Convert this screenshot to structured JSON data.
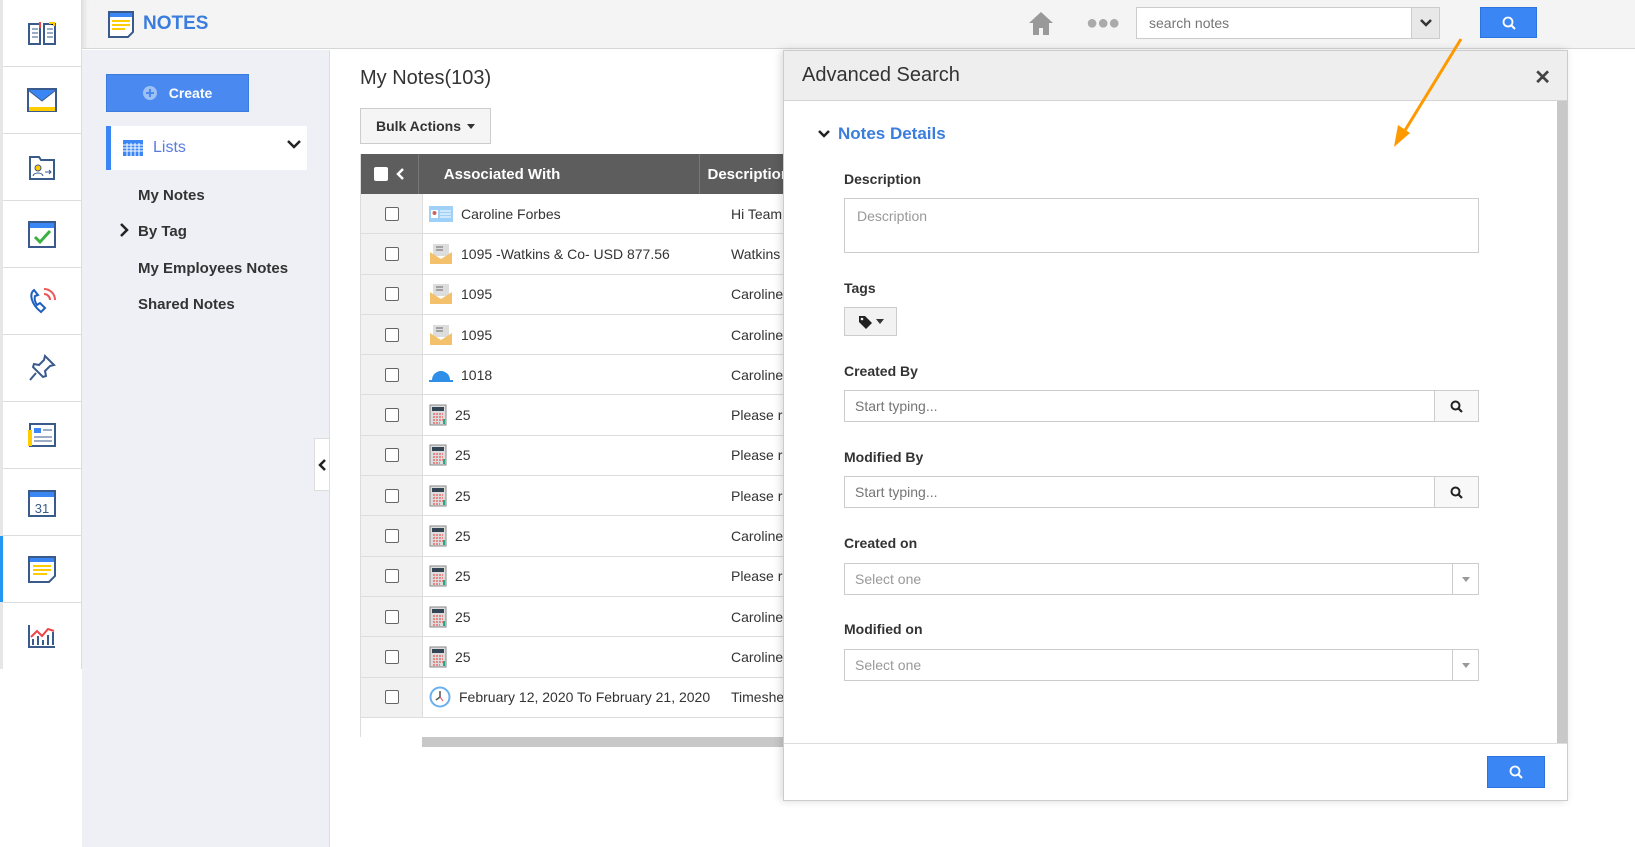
{
  "rail": {
    "items": [
      "book-icon",
      "mail-icon",
      "contacts-folder-icon",
      "calendar-check-icon",
      "phone-icon",
      "pin-icon",
      "news-icon",
      "calendar-31-icon",
      "notes-icon",
      "chart-icon"
    ],
    "active": "notes-icon",
    "calendar_day": "31"
  },
  "header": {
    "title": "NOTES",
    "search_placeholder": "search notes"
  },
  "sidebar": {
    "create_label": "Create",
    "lists_label": "Lists",
    "items": [
      {
        "label": "My Notes"
      },
      {
        "label": "By Tag"
      },
      {
        "label": "My Employees Notes"
      },
      {
        "label": "Shared Notes"
      }
    ]
  },
  "main": {
    "title": "My Notes(103)",
    "bulk_actions": "Bulk Actions",
    "columns": [
      "Associated With",
      "Description"
    ],
    "rows": [
      {
        "icon": "contact-card",
        "assoc": "Caroline Forbes",
        "desc": "Hi Team"
      },
      {
        "icon": "invoice-envelope",
        "assoc": "1095 -Watkins & Co- USD 877.56",
        "desc": "Watkins"
      },
      {
        "icon": "invoice-envelope",
        "assoc": "1095",
        "desc": "Caroline"
      },
      {
        "icon": "invoice-envelope",
        "assoc": "1095",
        "desc": "Caroline"
      },
      {
        "icon": "cap",
        "assoc": "1018",
        "desc": "Caroline"
      },
      {
        "icon": "calculator",
        "assoc": "25",
        "desc": "Please r"
      },
      {
        "icon": "calculator",
        "assoc": "25",
        "desc": "Please r"
      },
      {
        "icon": "calculator",
        "assoc": "25",
        "desc": "Please r"
      },
      {
        "icon": "calculator",
        "assoc": "25",
        "desc": "Caroline"
      },
      {
        "icon": "calculator",
        "assoc": "25",
        "desc": "Please r"
      },
      {
        "icon": "calculator",
        "assoc": "25",
        "desc": "Caroline"
      },
      {
        "icon": "calculator",
        "assoc": "25",
        "desc": "Caroline"
      },
      {
        "icon": "clock",
        "assoc": "February 12, 2020 To February 21, 2020",
        "desc": "Timeshe"
      }
    ]
  },
  "advanced_search": {
    "title": "Advanced Search",
    "section": "Notes Details",
    "description_label": "Description",
    "description_placeholder": "Description",
    "tags_label": "Tags",
    "created_by_label": "Created By",
    "created_by_placeholder": "Start typing...",
    "modified_by_label": "Modified By",
    "modified_by_placeholder": "Start typing...",
    "created_on_label": "Created on",
    "created_on_value": "Select one",
    "modified_on_label": "Modified on",
    "modified_on_value": "Select one"
  },
  "colors": {
    "accent": "#3b86f5",
    "header_dark": "#5d5d5d",
    "annotation_arrow": "#ff9900"
  }
}
